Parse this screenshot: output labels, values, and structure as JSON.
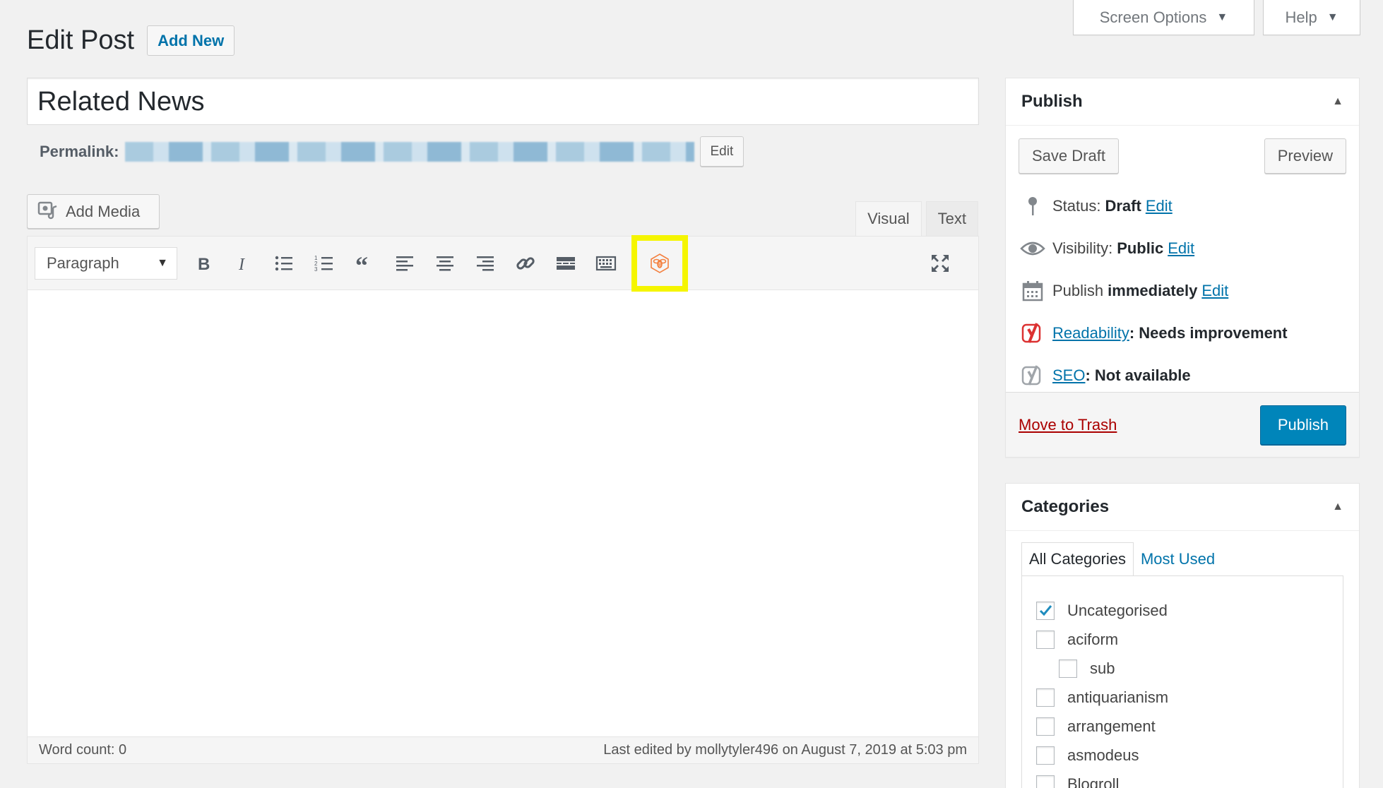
{
  "top_meta": {
    "screen_options": "Screen Options",
    "help": "Help"
  },
  "heading": {
    "title": "Edit Post",
    "add_new": "Add New"
  },
  "post": {
    "title": "Related News",
    "permalink_label": "Permalink:",
    "permalink_edit": "Edit"
  },
  "editor": {
    "add_media": "Add Media",
    "tab_visual": "Visual",
    "tab_text": "Text",
    "format": "Paragraph",
    "word_count": "Word count: 0",
    "last_edited": "Last edited by mollytyler496 on August 7, 2019 at 5:03 pm",
    "toolbar_icons": [
      "bold-icon",
      "italic-icon",
      "bulleted-list-icon",
      "numbered-list-icon",
      "blockquote-icon",
      "align-left-icon",
      "align-center-icon",
      "align-right-icon",
      "link-icon",
      "read-more-icon",
      "toolbar-toggle-icon",
      "beehive-icon",
      "fullscreen-icon"
    ],
    "highlight_color": "#f5f500",
    "highlighted_icon_color": "#f4803f"
  },
  "publish": {
    "title": "Publish",
    "save_draft": "Save Draft",
    "preview": "Preview",
    "status_label": "Status:",
    "status_value": "Draft",
    "visibility_label": "Visibility:",
    "visibility_value": "Public",
    "publish_label": "Publish",
    "publish_value": "immediately",
    "edit": "Edit",
    "readability_link": "Readability",
    "readability_value": ": Needs improvement",
    "seo_link": "SEO",
    "seo_value": ": Not available",
    "trash": "Move to Trash",
    "publish_button": "Publish",
    "primary_color": "#0085ba",
    "trash_color": "#a00"
  },
  "categories": {
    "title": "Categories",
    "tab_all": "All Categories",
    "tab_most_used": "Most Used",
    "items": [
      {
        "label": "Uncategorised",
        "checked": true
      },
      {
        "label": "aciform",
        "checked": false
      },
      {
        "label": "sub",
        "checked": false
      },
      {
        "label": "antiquarianism",
        "checked": false
      },
      {
        "label": "arrangement",
        "checked": false
      },
      {
        "label": "asmodeus",
        "checked": false
      },
      {
        "label": "Blogroll",
        "checked": false
      }
    ]
  }
}
